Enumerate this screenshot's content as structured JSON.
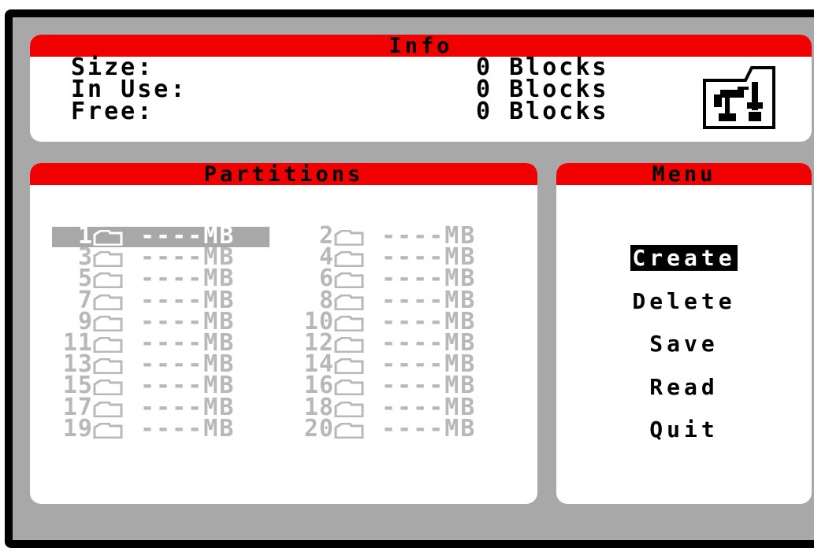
{
  "info": {
    "title": "Info",
    "rows": [
      {
        "label": "Size:",
        "value": "0 Blocks"
      },
      {
        "label": "In Use:",
        "value": "0 Blocks"
      },
      {
        "label": "Free:",
        "value": "0 Blocks"
      }
    ]
  },
  "partitions": {
    "title": "Partitions",
    "selected_index": 0,
    "entries": [
      {
        "number": "1",
        "size": "----MB"
      },
      {
        "number": "2",
        "size": "----MB"
      },
      {
        "number": "3",
        "size": "----MB"
      },
      {
        "number": "4",
        "size": "----MB"
      },
      {
        "number": "5",
        "size": "----MB"
      },
      {
        "number": "6",
        "size": "----MB"
      },
      {
        "number": "7",
        "size": "----MB"
      },
      {
        "number": "8",
        "size": "----MB"
      },
      {
        "number": "9",
        "size": "----MB"
      },
      {
        "number": "10",
        "size": "----MB"
      },
      {
        "number": "11",
        "size": "----MB"
      },
      {
        "number": "12",
        "size": "----MB"
      },
      {
        "number": "13",
        "size": "----MB"
      },
      {
        "number": "14",
        "size": "----MB"
      },
      {
        "number": "15",
        "size": "----MB"
      },
      {
        "number": "16",
        "size": "----MB"
      },
      {
        "number": "17",
        "size": "----MB"
      },
      {
        "number": "18",
        "size": "----MB"
      },
      {
        "number": "19",
        "size": "----MB"
      },
      {
        "number": "20",
        "size": "----MB"
      }
    ]
  },
  "menu": {
    "title": "Menu",
    "selected_index": 0,
    "items": [
      "Create",
      "Delete",
      "Save",
      "Read",
      "Quit"
    ]
  },
  "icons": {
    "info": "hard-disk-tool-icon",
    "partition": "folder-icon"
  },
  "colors": {
    "header": "#f00000",
    "background": "#a8a8a8",
    "disabled_text": "#b8b8b8"
  }
}
